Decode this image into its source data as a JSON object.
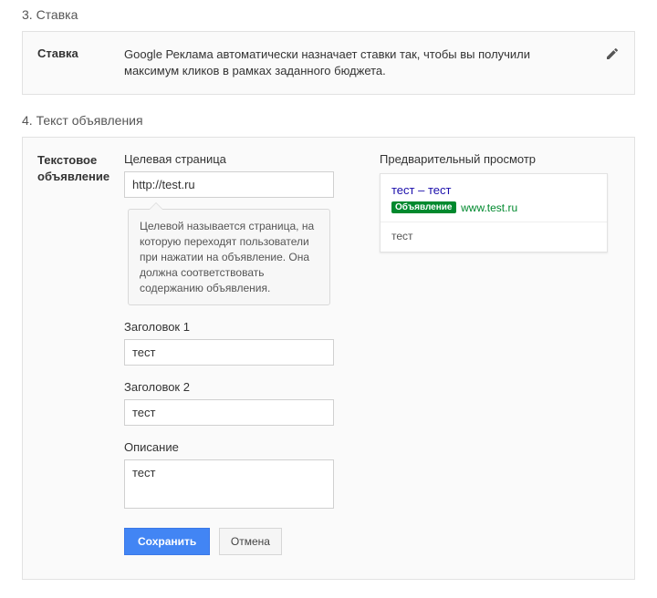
{
  "section3": {
    "title": "3. Ставка",
    "label": "Ставка",
    "description": "Google Реклама автоматически назначает ставки так, чтобы вы получили максимум кликов в рамках заданного бюджета."
  },
  "section4": {
    "title": "4. Текст объявления",
    "label_line1": "Текстовое",
    "label_line2": "объявление",
    "landing": {
      "label": "Целевая страница",
      "value": "http://test.ru",
      "hint": "Целевой называется страница, на которую переходят пользователи при нажатии на объявление. Она должна соответствовать содержанию объявления."
    },
    "headline1": {
      "label": "Заголовок 1",
      "value": "тест"
    },
    "headline2": {
      "label": "Заголовок 2",
      "value": "тест"
    },
    "description": {
      "label": "Описание",
      "value": "тест"
    },
    "buttons": {
      "save": "Сохранить",
      "cancel": "Отмена"
    }
  },
  "preview": {
    "title": "Предварительный просмотр",
    "headline": "тест – тест",
    "badge": "Объявление",
    "url": "www.test.ru",
    "description": "тест"
  }
}
